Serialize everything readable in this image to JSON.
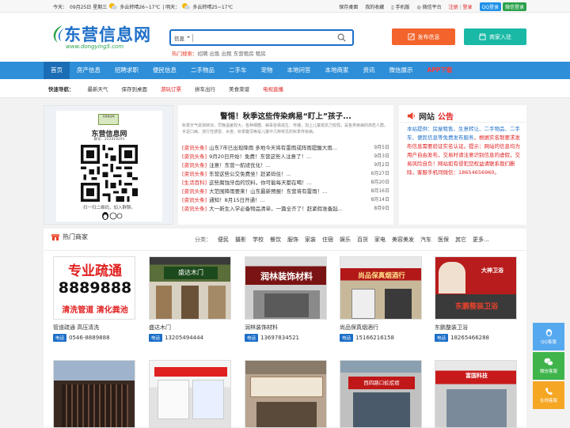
{
  "topbar": {
    "today_label": "今天：",
    "date": "09月25日 星期三",
    "today_weather": "多云转晴26~17℃",
    "tomorrow_label": "| 明天：",
    "tomorrow_weather": "多云转晴25~17℃",
    "links": [
      "保存桌面",
      "我的收藏",
      "手机版",
      "微信平台"
    ],
    "register": "注册",
    "login": "登录",
    "qq_login": "QQ登录",
    "wechat_login": "微信登录"
  },
  "header": {
    "logo_text": "东营信息网",
    "logo_url": "www.dongying5.com",
    "search_category": "信息",
    "search_placeholder": "",
    "hot_label": "热门搜索：",
    "hot_items": "招聘 出售 出租 东营租房 租房",
    "post_button": "发布信息",
    "join_button": "商家入驻"
  },
  "nav": {
    "items": [
      "首页",
      "房产信息",
      "招聘求职",
      "便民信息",
      "二手物品",
      "二手车",
      "宠物",
      "本地问答",
      "本地商家",
      "资讯",
      "微信展示",
      "APP下载"
    ]
  },
  "quick": {
    "label": "快速导航：",
    "items": [
      "最新天气",
      "保存到桌面",
      "游玩订票",
      "拼车出行",
      "美食菜谱",
      "电视直播"
    ]
  },
  "qr": {
    "sticker_text": "东营信息网",
    "title": "东营信息网",
    "subtitle": "群号：222419291",
    "caption": "扫一扫二维码，加入群聊。"
  },
  "news": {
    "headline": "警惕！秋季这些传染病易“盯上”孩子...",
    "summary": "秋季天气逐渐转凉，早晚温差较大，各种细菌、病毒容易滋生、传播，加上儿童抵抗力较弱，是各类疾病的高危人群。手足口病、流行性感冒、水痘、秋季腹泻等是儿童中几种常见的秋季传染病。",
    "items": [
      {
        "tag": "[资讯头条]",
        "title": "山东7市已出现降雨 多地今天将有雷雨或阵雨提醒大雨...",
        "date": "9月5日"
      },
      {
        "tag": "[资讯头条]",
        "title": "9月20日开始！免费！东营这些人注意了！...",
        "date": "9月3日"
      },
      {
        "tag": "[资讯头条]",
        "title": "注意！东营一航班优化！...",
        "date": "9月2日"
      },
      {
        "tag": "[资讯头条]",
        "title": "东营这些公交免费坐！赶紧码住！...",
        "date": "6月27日"
      },
      {
        "tag": "[生活百科]",
        "title": "这些腐蚀牙齿的饮料，你可能每天都在喝！...",
        "date": "8月20日"
      },
      {
        "tag": "[资讯头条]",
        "title": "大范围降雨要来！山东最新预报！东营将有雷雨！...",
        "date": "8月16日"
      },
      {
        "tag": "[资讯头条]",
        "title": "通知！8月15日开通！...",
        "date": "8月14日"
      },
      {
        "tag": "[资讯头条]",
        "title": "大一新生入学必备物品清单，一篇全齐了！赶紧假准备起...",
        "date": "8月9日"
      }
    ]
  },
  "notice": {
    "title_a": "网站",
    "title_b": "公告",
    "body_prefix": "本站提供：",
    "body_categories": "房屋租售、生意转让、二手物品、二手车、便民信息等免费发布服务",
    "body_rest": "，根据实名制要求发布信息需要验证实名认证。提示：网站的信息均为用户自由发布，交易时请注意识别信息的虚假，交易风险自负！网站如有侵犯您权益请联系我们删除，客服手机同微信：18654656960。"
  },
  "shops": {
    "title": "热门商家",
    "cats_label": "分类：",
    "cats": [
      "便民",
      "摄影",
      "学校",
      "餐饮",
      "服饰",
      "家装",
      "住宿",
      "娱乐",
      "百货",
      "家电",
      "美容美发",
      "汽车",
      "医保",
      "其它",
      "更多..."
    ],
    "tel_label": "电话",
    "cards": [
      {
        "name": "管道疏通 高压清洗",
        "phone": "0546-8889888",
        "sign_a": "专业疏通",
        "sign_b": "8889888",
        "sign_c": "清洗管道 清化粪池"
      },
      {
        "name": "盛达木门",
        "phone": "13205494444",
        "sign_a": "盛达木门"
      },
      {
        "name": "润林装饰材料",
        "phone": "13697834521",
        "sign_a": "润林装饰材料"
      },
      {
        "name": "尚品保真烟酒行",
        "phone": "15166216158",
        "sign_a": "尚品保真烟酒行"
      },
      {
        "name": "东鹏整装卫浴",
        "phone": "18265466288",
        "sign_a": "东鹏整装卫浴",
        "sign_b": "大神卫浴"
      }
    ],
    "row2_signs": [
      "",
      "",
      "",
      "西四路口蛇疙瘩",
      "富国科技"
    ]
  },
  "side": {
    "items": [
      "QQ客服",
      "微信客服",
      "在线客服"
    ]
  },
  "colors": {
    "brand_blue": "#2e8fd8",
    "orange": "#f2642c",
    "teal": "#19b9a6",
    "red": "#e02020"
  }
}
